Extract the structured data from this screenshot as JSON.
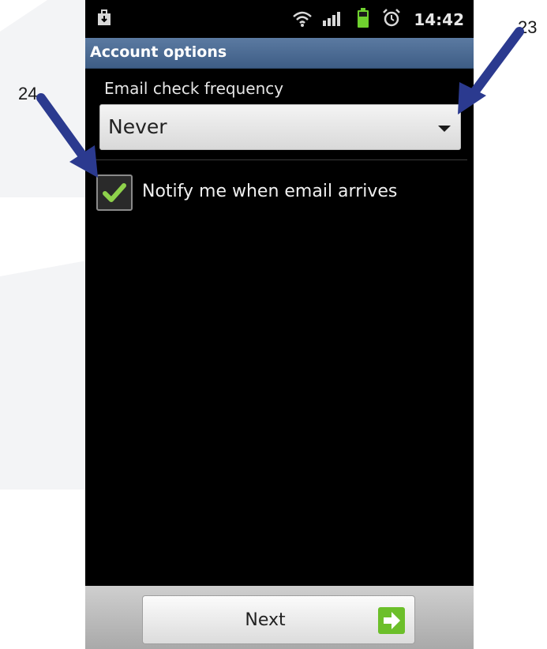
{
  "status_bar": {
    "time": "14:42",
    "icons": [
      "download-notification-icon",
      "wifi-icon",
      "signal-icon",
      "battery-icon",
      "alarm-icon"
    ]
  },
  "title_bar": {
    "title": "Account options"
  },
  "email_check": {
    "label": "Email check frequency",
    "selected_value": "Never"
  },
  "notify": {
    "label": "Notify me when email arrives",
    "checked": true
  },
  "footer": {
    "next_label": "Next"
  },
  "callouts": {
    "dropdown_number": "23",
    "checkbox_number": "24"
  },
  "colors": {
    "title_bar": "#4a6a94",
    "arrow": "#2b3a8f",
    "check": "#8ed14b",
    "next_arrow": "#6cbf2a"
  }
}
